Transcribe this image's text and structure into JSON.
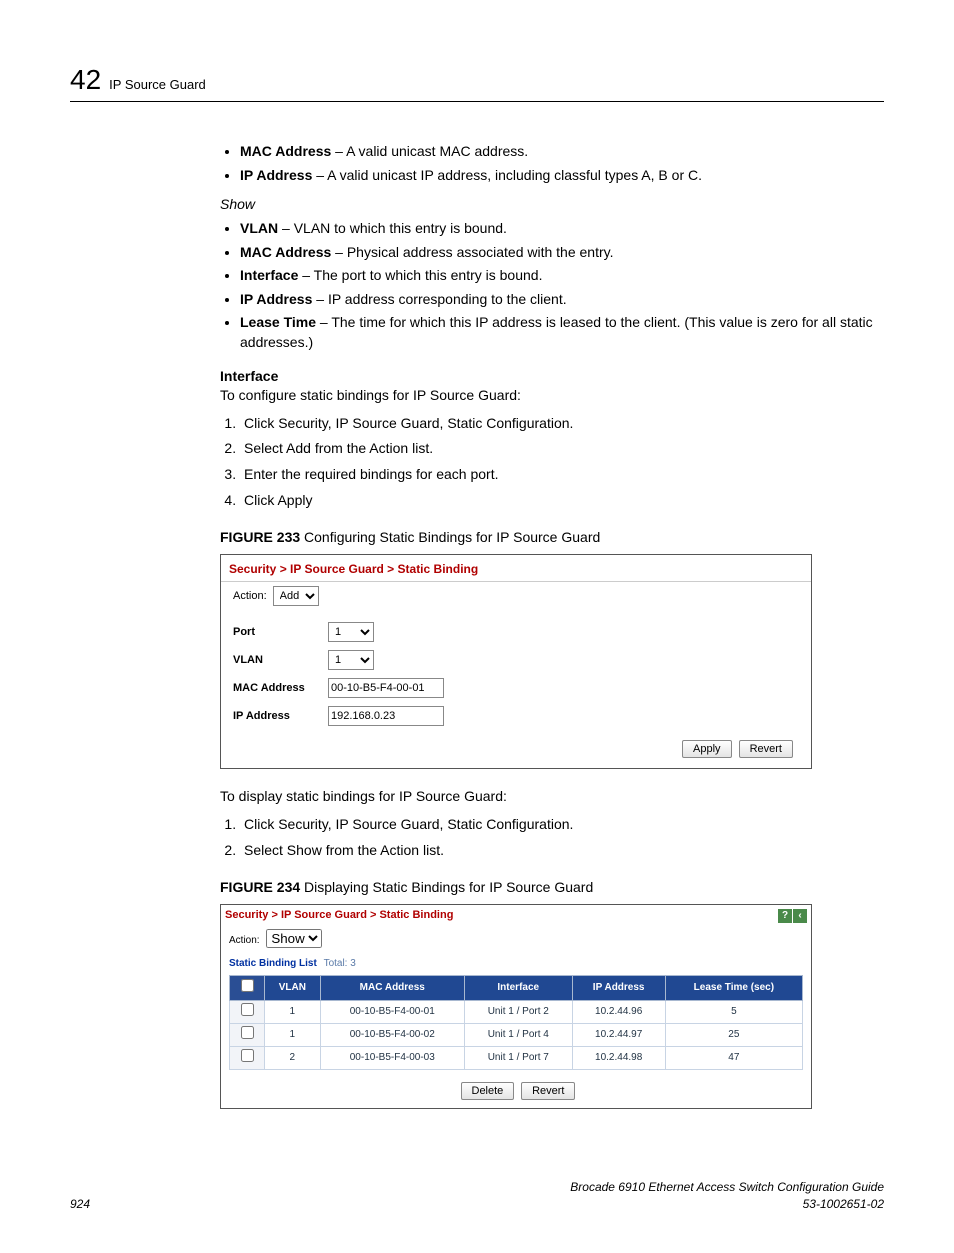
{
  "header": {
    "chapter_number": "42",
    "chapter_title": "IP Source Guard"
  },
  "intro_bullets": [
    {
      "term": "MAC Address",
      "desc": " – A valid unicast MAC address."
    },
    {
      "term": "IP Address",
      "desc": " – A valid unicast IP address, including classful types A, B or C."
    }
  ],
  "show_heading": "Show",
  "show_bullets": [
    {
      "term": "VLAN",
      "desc": " – VLAN to which this entry is bound."
    },
    {
      "term": "MAC Address",
      "desc": " – Physical address associated with the entry."
    },
    {
      "term": "Interface",
      "desc": " – The port to which this entry is bound."
    },
    {
      "term": "IP Address",
      "desc": " – IP address corresponding to the client."
    },
    {
      "term": "Lease Time",
      "desc": " – The time for which this IP address is leased to the client. (This value is zero for all static addresses.)"
    }
  ],
  "interface_heading": "Interface",
  "interface_intro": "To configure static bindings for IP Source Guard:",
  "interface_steps": [
    "Click Security, IP Source Guard, Static Configuration.",
    "Select Add from the Action list.",
    "Enter the required bindings for each port.",
    "Click Apply"
  ],
  "fig233": {
    "label": "FIGURE 233",
    "caption": "  Configuring Static Bindings for IP Source Guard",
    "breadcrumb": "Security > IP Source Guard > Static Binding",
    "action_label": "Action:",
    "action_value": "Add",
    "fields": {
      "port_label": "Port",
      "port_value": "1",
      "vlan_label": "VLAN",
      "vlan_value": "1",
      "mac_label": "MAC Address",
      "mac_value": "00-10-B5-F4-00-01",
      "ip_label": "IP Address",
      "ip_value": "192.168.0.23"
    },
    "apply": "Apply",
    "revert": "Revert"
  },
  "display_intro": "To display static bindings for IP Source Guard:",
  "display_steps": [
    "Click Security, IP Source Guard, Static Configuration.",
    "Select Show from the Action list."
  ],
  "fig234": {
    "label": "FIGURE 234",
    "caption": "  Displaying Static Bindings for IP Source Guard",
    "breadcrumb": "Security > IP Source Guard > Static Binding",
    "action_label": "Action:",
    "action_value": "Show",
    "list_title": "Static Binding List",
    "list_total": "Total: 3",
    "columns": [
      "VLAN",
      "MAC Address",
      "Interface",
      "IP Address",
      "Lease Time (sec)"
    ],
    "rows": [
      {
        "vlan": "1",
        "mac": "00-10-B5-F4-00-01",
        "iface": "Unit 1 / Port 2",
        "ip": "10.2.44.96",
        "lease": "5"
      },
      {
        "vlan": "1",
        "mac": "00-10-B5-F4-00-02",
        "iface": "Unit 1 / Port 4",
        "ip": "10.2.44.97",
        "lease": "25"
      },
      {
        "vlan": "2",
        "mac": "00-10-B5-F4-00-03",
        "iface": "Unit 1 / Port 7",
        "ip": "10.2.44.98",
        "lease": "47"
      }
    ],
    "delete": "Delete",
    "revert": "Revert"
  },
  "footer": {
    "page": "924",
    "guide": "Brocade 6910 Ethernet Access Switch Configuration Guide",
    "docnum": "53-1002651-02"
  }
}
